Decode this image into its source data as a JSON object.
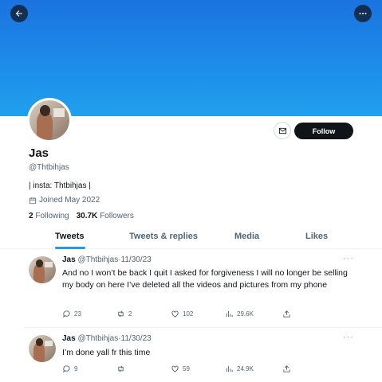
{
  "profile": {
    "name": "Jas",
    "handle": "@Thtbihjas",
    "bio": "| insta: Thtbihjas |",
    "joined": "Joined May 2022",
    "following_count": "2",
    "following_label": "Following",
    "followers_count": "30.7K",
    "followers_label": "Followers",
    "follow_button": "Follow"
  },
  "tabs": [
    {
      "label": "Tweets",
      "active": true
    },
    {
      "label": "Tweets & replies",
      "active": false
    },
    {
      "label": "Media",
      "active": false
    },
    {
      "label": "Likes",
      "active": false
    }
  ],
  "tweets": [
    {
      "name": "Jas",
      "handle": "@Thtbihjas",
      "separator": "·",
      "date": "11/30/23",
      "more": "···",
      "text": "And no I won’t be back I quit I asked for forgiveness I will no longer be selling my body on here I’ve deleted all the videos and pictures from my phone",
      "replies": "23",
      "retweets": "2",
      "likes": "102",
      "views": "29.6K"
    },
    {
      "name": "Jas",
      "handle": "@Thtbihjas",
      "separator": "·",
      "date": "11/30/23",
      "more": "···",
      "text": "I’m done yall fr this time",
      "replies": "9",
      "retweets": "",
      "likes": "59",
      "views": "24.9K"
    }
  ],
  "icons": {
    "back": "arrow-left-icon",
    "more": "more-dots-icon",
    "message": "envelope-icon",
    "calendar": "calendar-icon",
    "reply": "reply-icon",
    "retweet": "retweet-icon",
    "like": "heart-icon",
    "views": "views-bar-icon",
    "share": "share-icon"
  },
  "colors": {
    "banner": "#1d8ce8",
    "accent": "#1d9bf0",
    "follow_button": "#0f1419",
    "secondary_text": "#536471"
  }
}
